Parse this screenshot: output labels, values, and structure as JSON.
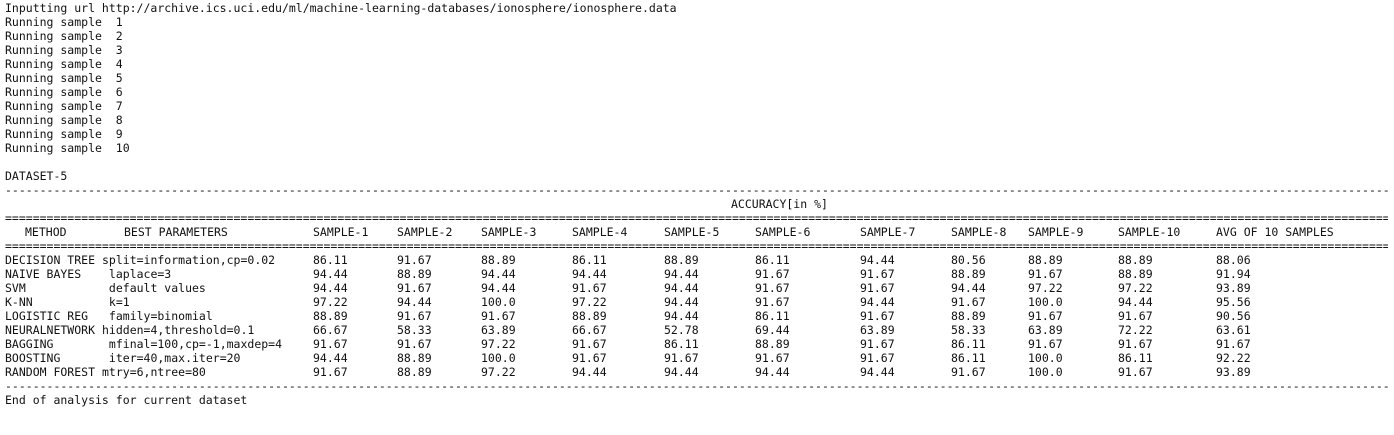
{
  "header": {
    "url_line": "Inputting url http://archive.ics.uci.edu/ml/machine-learning-databases/ionosphere/ionosphere.data",
    "samples": [
      "Running sample  1",
      "Running sample  2",
      "Running sample  3",
      "Running sample  4",
      "Running sample  5",
      "Running sample  6",
      "Running sample  7",
      "Running sample  8",
      "Running sample  9",
      "Running sample  10"
    ]
  },
  "dataset": {
    "label": "DATASET-5",
    "accuracy_title": "ACCURACY[in %]",
    "dash_rule": "------------------------------------------------------------------------------------------------------------------------------------------------------------------------------------------------------------------------------------------------------",
    "eq_rule": "======================================================================================================================================================================================================================================================",
    "columns": {
      "method": "METHOD",
      "params": "BEST PARAMETERS",
      "s1": "SAMPLE-1",
      "s2": "SAMPLE-2",
      "s3": "SAMPLE-3",
      "s4": "SAMPLE-4",
      "s5": "SAMPLE-5",
      "s6": "SAMPLE-6",
      "s7": "SAMPLE-7",
      "s8": "SAMPLE-8",
      "s9": "SAMPLE-9",
      "s10": "SAMPLE-10",
      "avg": "AVG OF 10 SAMPLES"
    },
    "rows": [
      {
        "method": "DECISION TREE",
        "params": "split=information,cp=0.02",
        "s1": "86.11",
        "s2": "91.67",
        "s3": "88.89",
        "s4": "86.11",
        "s5": "88.89",
        "s6": "86.11",
        "s7": "94.44",
        "s8": "80.56",
        "s9": "88.89",
        "s10": "88.89",
        "avg": "88.06"
      },
      {
        "method": "NAIVE BAYES",
        "params": " laplace=3",
        "s1": "94.44",
        "s2": "88.89",
        "s3": "94.44",
        "s4": "94.44",
        "s5": "94.44",
        "s6": "91.67",
        "s7": "91.67",
        "s8": "88.89",
        "s9": "91.67",
        "s10": "88.89",
        "avg": "91.94"
      },
      {
        "method": "SVM",
        "params": " default values",
        "s1": "94.44",
        "s2": "91.67",
        "s3": "94.44",
        "s4": "91.67",
        "s5": "94.44",
        "s6": "91.67",
        "s7": "91.67",
        "s8": "94.44",
        "s9": "97.22",
        "s10": "97.22",
        "avg": "93.89"
      },
      {
        "method": "K-NN",
        "params": " k=1",
        "s1": "97.22",
        "s2": "94.44",
        "s3": "100.0",
        "s4": "97.22",
        "s5": "94.44",
        "s6": "91.67",
        "s7": "94.44",
        "s8": "91.67",
        "s9": "100.0",
        "s10": "94.44",
        "avg": "95.56"
      },
      {
        "method": "LOGISTIC REG",
        "params": " family=binomial",
        "s1": "88.89",
        "s2": "91.67",
        "s3": "91.67",
        "s4": "88.89",
        "s5": "94.44",
        "s6": "86.11",
        "s7": "91.67",
        "s8": "88.89",
        "s9": "91.67",
        "s10": "91.67",
        "avg": "90.56"
      },
      {
        "method": "NEURALNETWORK",
        "params": "hidden=4,threshold=0.1",
        "s1": "66.67",
        "s2": "58.33",
        "s3": "63.89",
        "s4": "66.67",
        "s5": "52.78",
        "s6": "69.44",
        "s7": "63.89",
        "s8": "58.33",
        "s9": "63.89",
        "s10": "72.22",
        "avg": "63.61"
      },
      {
        "method": "BAGGING",
        "params": " mfinal=100,cp=-1,maxdep=4",
        "s1": "91.67",
        "s2": "91.67",
        "s3": "97.22",
        "s4": "91.67",
        "s5": "86.11",
        "s6": "88.89",
        "s7": "91.67",
        "s8": "86.11",
        "s9": "91.67",
        "s10": "91.67",
        "avg": "91.67"
      },
      {
        "method": "BOOSTING",
        "params": " iter=40,max.iter=20",
        "s1": "94.44",
        "s2": "88.89",
        "s3": "100.0",
        "s4": "91.67",
        "s5": "91.67",
        "s6": "91.67",
        "s7": "91.67",
        "s8": "86.11",
        "s9": "100.0",
        "s10": "86.11",
        "avg": "92.22"
      },
      {
        "method": "RANDOM FOREST",
        "params": "mtry=6,ntree=80",
        "s1": "91.67",
        "s2": "88.89",
        "s3": "97.22",
        "s4": "94.44",
        "s5": "94.44",
        "s6": "94.44",
        "s7": "94.44",
        "s8": "91.67",
        "s9": "100.0",
        "s10": "91.67",
        "avg": "93.89"
      }
    ]
  },
  "footer": {
    "end_line": "End of analysis for current dataset"
  }
}
